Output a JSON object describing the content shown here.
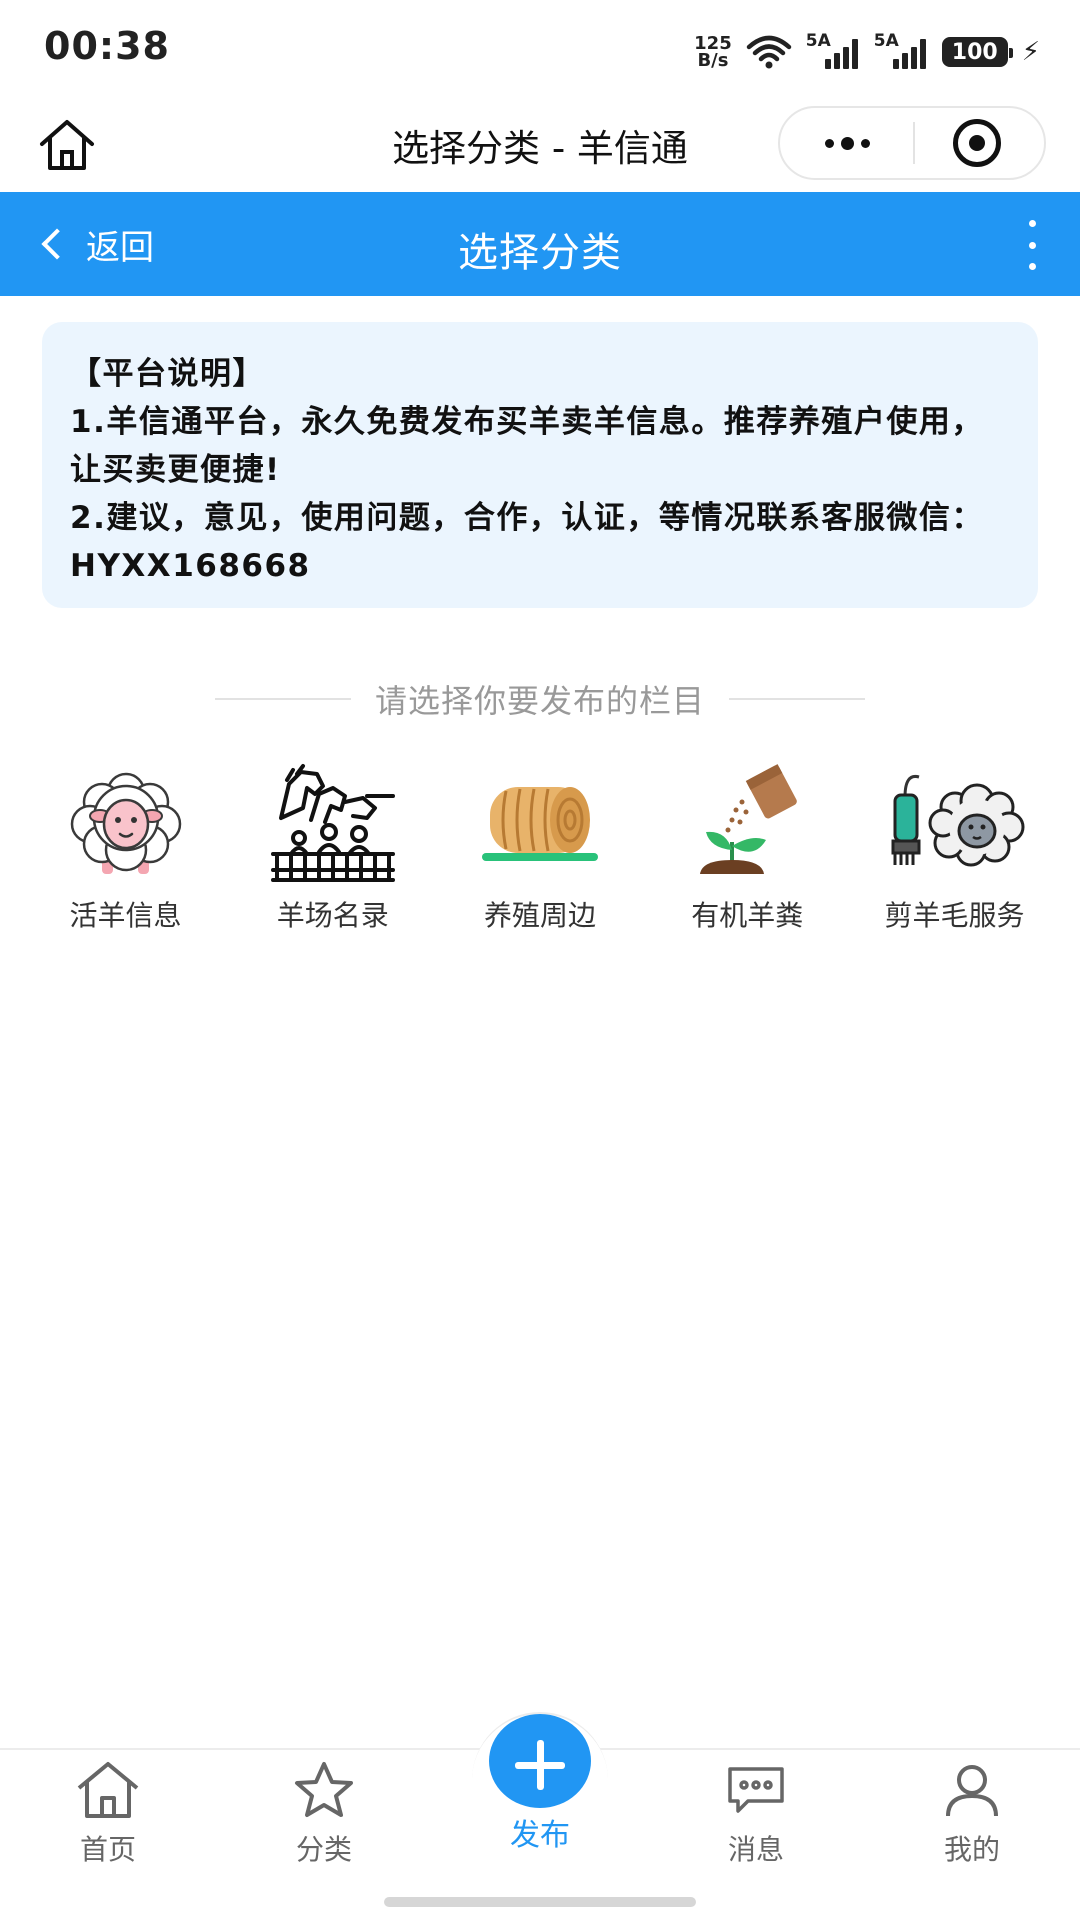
{
  "status_bar": {
    "time": "00:38",
    "net_speed_value": "125",
    "net_speed_unit": "B/s",
    "signal1_label": "5A",
    "signal2_label": "5A",
    "battery": "100"
  },
  "mp_nav": {
    "title": "选择分类 - 羊信通"
  },
  "header": {
    "back_label": "返回",
    "title": "选择分类"
  },
  "notice": {
    "lines": [
      "【平台说明】",
      "1.羊信通平台，永久免费发布买羊卖羊信息。推荐养殖户使用，让买卖更便捷!",
      "2.建议，意见，使用问题，合作，认证，等情况联系客服微信：HYXX168668"
    ]
  },
  "section": {
    "title": "请选择你要发布的栏目"
  },
  "categories": [
    {
      "label": "活羊信息",
      "icon": "sheep-icon"
    },
    {
      "label": "羊场名录",
      "icon": "farm-animals-icon"
    },
    {
      "label": "养殖周边",
      "icon": "hay-bale-icon"
    },
    {
      "label": "有机羊粪",
      "icon": "fertilizer-sprout-icon"
    },
    {
      "label": "剪羊毛服务",
      "icon": "shearing-clipper-icon"
    }
  ],
  "tabbar": {
    "home": "首页",
    "category": "分类",
    "publish": "发布",
    "messages": "消息",
    "mine": "我的"
  },
  "colors": {
    "primary": "#2196f3",
    "notice_bg": "#ebf5fe",
    "muted_text": "#999999"
  }
}
